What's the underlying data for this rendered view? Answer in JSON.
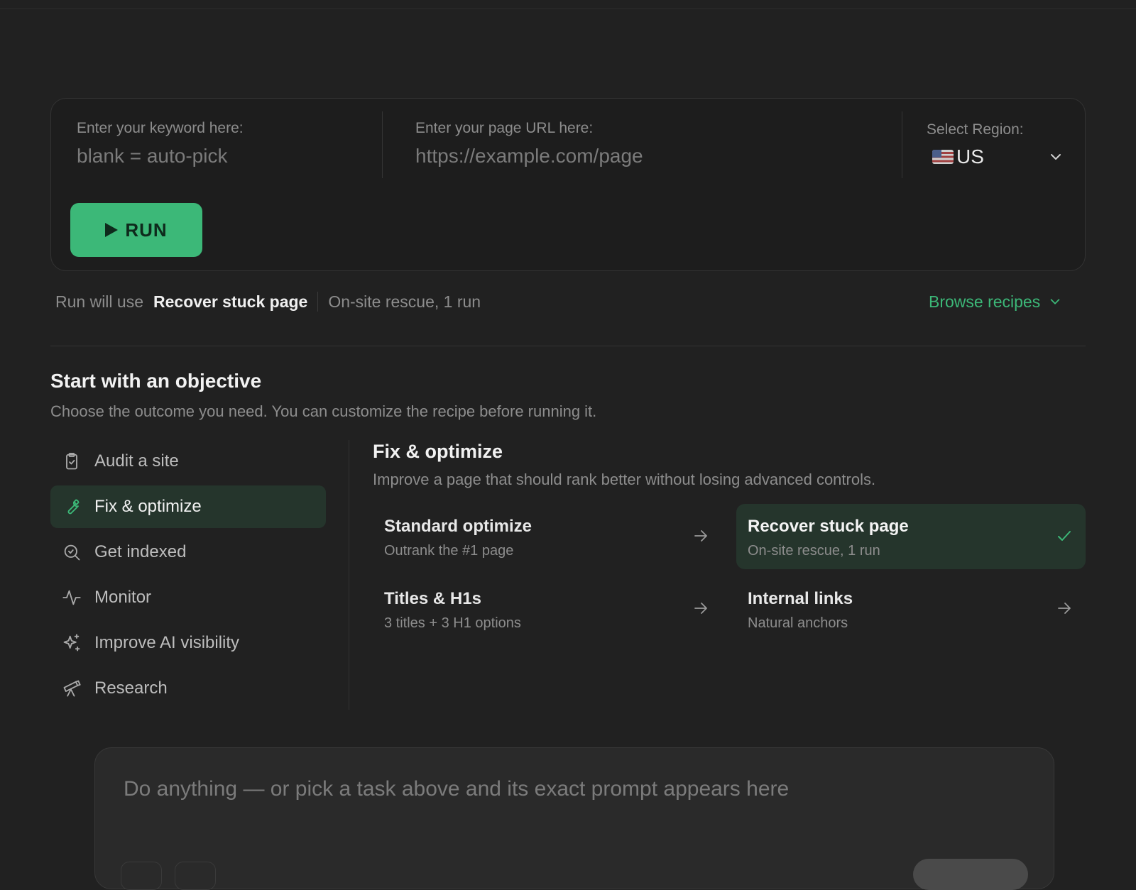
{
  "form": {
    "keyword_label": "Enter your keyword here:",
    "keyword_placeholder": "blank = auto-pick",
    "url_label": "Enter your page URL here:",
    "url_placeholder": "https://example.com/page",
    "region_label": "Select Region:",
    "region_value": "US",
    "region_flag": "us-flag-icon",
    "run_label": "RUN"
  },
  "recipe": {
    "prefix": "Run will use",
    "name": "Recover stuck page",
    "detail": "On-site rescue, 1 run",
    "browse_label": "Browse recipes"
  },
  "objective": {
    "title": "Start with an objective",
    "subtitle": "Choose the outcome you need. You can customize the recipe before running it."
  },
  "sidebar": {
    "items": [
      {
        "label": "Audit a site",
        "icon": "clipboard-check-icon",
        "active": false
      },
      {
        "label": "Fix & optimize",
        "icon": "wrench-icon",
        "active": true
      },
      {
        "label": "Get indexed",
        "icon": "search-icon",
        "active": false
      },
      {
        "label": "Monitor",
        "icon": "activity-icon",
        "active": false
      },
      {
        "label": "Improve AI visibility",
        "icon": "sparkles-icon",
        "active": false
      },
      {
        "label": "Research",
        "icon": "telescope-icon",
        "active": false
      }
    ]
  },
  "panel": {
    "title": "Fix & optimize",
    "subtitle": "Improve a page that should rank better without losing advanced controls.",
    "options": [
      {
        "title": "Standard optimize",
        "subtitle": "Outrank the #1 page",
        "selected": false
      },
      {
        "title": "Recover stuck page",
        "subtitle": "On-site rescue, 1 run",
        "selected": true
      },
      {
        "title": "Titles & H1s",
        "subtitle": "3 titles + 3 H1 options",
        "selected": false
      },
      {
        "title": "Internal links",
        "subtitle": "Natural anchors",
        "selected": false
      }
    ]
  },
  "prompt": {
    "placeholder": "Do anything — or pick a task above and its exact prompt appears here"
  },
  "colors": {
    "accent": "#3cb878",
    "background": "#212121",
    "active_bg": "#25352c"
  }
}
